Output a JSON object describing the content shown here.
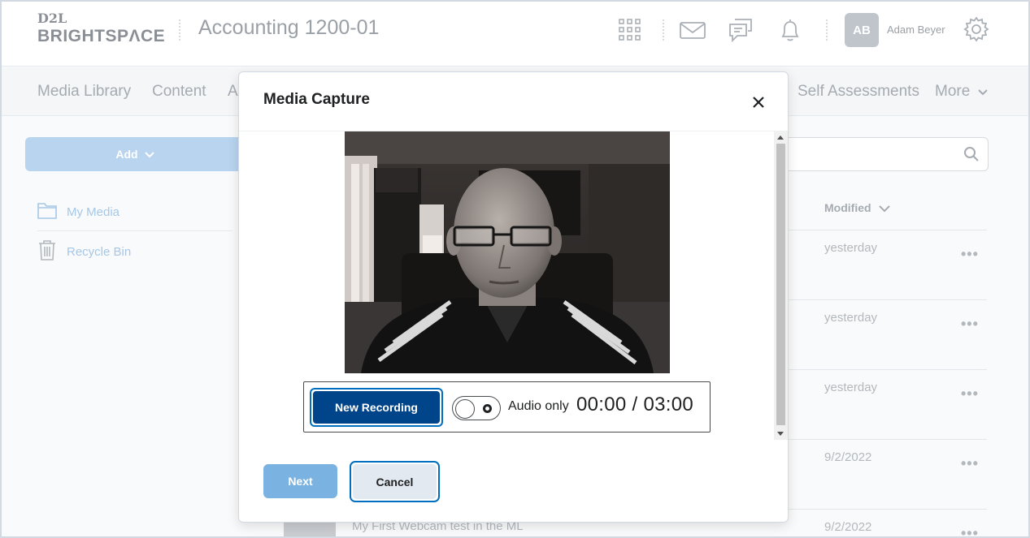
{
  "header": {
    "logo_top": "D2L",
    "logo_bottom": "BRIGHTSPΛCE",
    "course_title": "Accounting 1200-01",
    "avatar_initials": "AB",
    "user_name": "Adam Beyer",
    "icons": [
      "grid-icon",
      "mail-icon",
      "chat-icon",
      "bell-icon",
      "gear-icon"
    ]
  },
  "nav": {
    "items": [
      "Media Library",
      "Content",
      "A",
      "Self Assessments",
      "More"
    ]
  },
  "sidebar": {
    "add_label": "Add",
    "items": [
      {
        "label": "My Media",
        "icon": "folder-icon"
      },
      {
        "label": "Recycle Bin",
        "icon": "trash-icon"
      }
    ]
  },
  "list": {
    "modified_header": "Modified",
    "rows": [
      {
        "modified": "yesterday"
      },
      {
        "modified": "yesterday"
      },
      {
        "modified": "yesterday"
      },
      {
        "modified": "9/2/2022"
      },
      {
        "modified": "9/2/2022",
        "title": "My First Webcam test in the ML"
      }
    ]
  },
  "modal": {
    "title": "Media Capture",
    "new_recording_label": "New Recording",
    "audio_only_label": "Audio only",
    "timer": "00:00 / 03:00",
    "next_label": "Next",
    "cancel_label": "Cancel"
  },
  "colors": {
    "primary": "#004489",
    "focus_ring": "#006fbf",
    "disabled_primary": "#7ab3e2",
    "text": "#202122"
  }
}
